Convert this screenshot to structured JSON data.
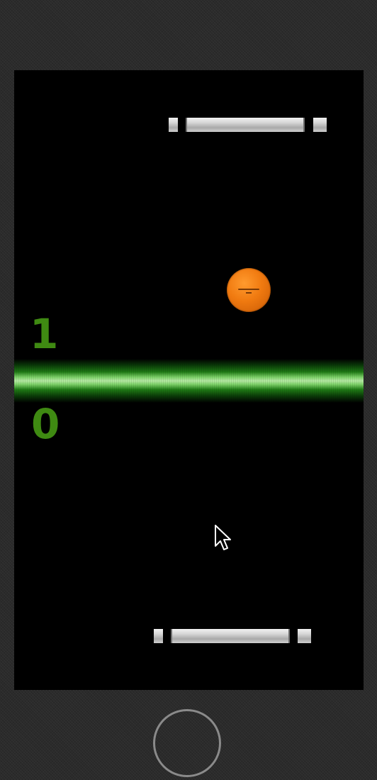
{
  "game": {
    "title": "",
    "scores": {
      "top_player": "1",
      "bottom_player": "0"
    },
    "ball": {
      "color": "#f07a10"
    },
    "net": {
      "color": "#7fd36a"
    },
    "score_color": "#3f8a12"
  },
  "device": {
    "home_button": "home-button"
  },
  "icons": {
    "cursor": "mouse-pointer-icon"
  }
}
